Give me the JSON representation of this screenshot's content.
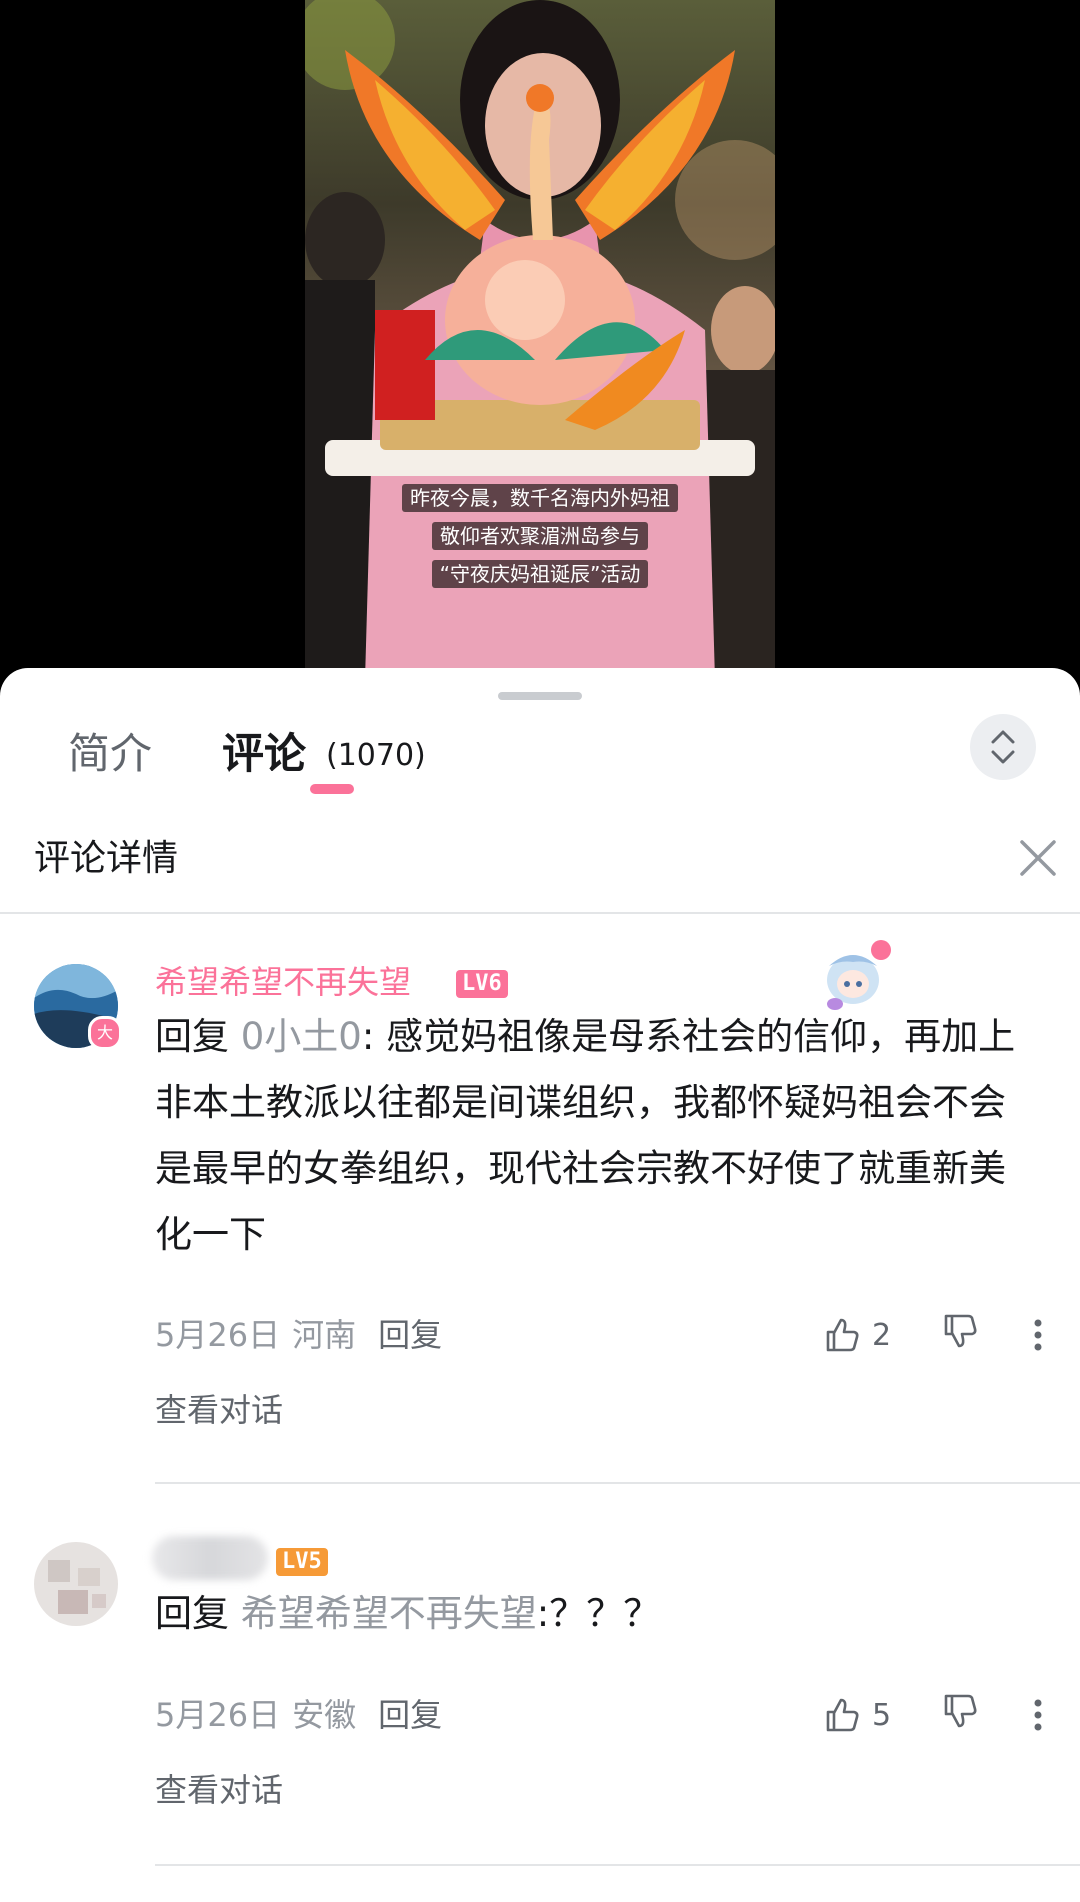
{
  "video": {
    "subtitle_lines": [
      "昨夜今晨，数千名海内外妈祖",
      "敬仰者欢聚湄洲岛参与",
      "“守夜庆妈祖诞辰”活动"
    ]
  },
  "tabs": {
    "intro_label": "简介",
    "comments_label": "评论",
    "comments_count": "(1070)"
  },
  "detail_header": {
    "title": "评论详情"
  },
  "comments": [
    {
      "username": "希望希望不再失望",
      "level": "LV6",
      "avatar_badge": "大",
      "reply_prefix": "回复 ",
      "reply_target": "0小土0",
      "text": ": 感觉妈祖像是母系社会的信仰，再加上非本土教派以往都是间谍组织，我都怀疑妈祖会不会是最早的女拳组织，现代社会宗教不好使了就重新美化一下",
      "date": "5月26日",
      "location": "河南",
      "reply_label": "回复",
      "likes": "2",
      "view_thread_label": "查看对话"
    },
    {
      "username": "",
      "level": "LV5",
      "reply_prefix": "回复 ",
      "reply_target": "希望希望不再失望",
      "text": ":？？？",
      "date": "5月26日",
      "location": "安徽",
      "reply_label": "回复",
      "likes": "5",
      "view_thread_label": "查看对话"
    }
  ],
  "colors": {
    "accent_pink": "#fb7299",
    "level_orange": "#f69a37",
    "text_primary": "#18191c",
    "text_secondary": "#9499a0"
  },
  "icons": {
    "expand": "expand-collapse-icon",
    "close": "close-icon",
    "like": "thumbs-up-icon",
    "dislike": "thumbs-down-icon",
    "more": "more-vertical-icon"
  }
}
